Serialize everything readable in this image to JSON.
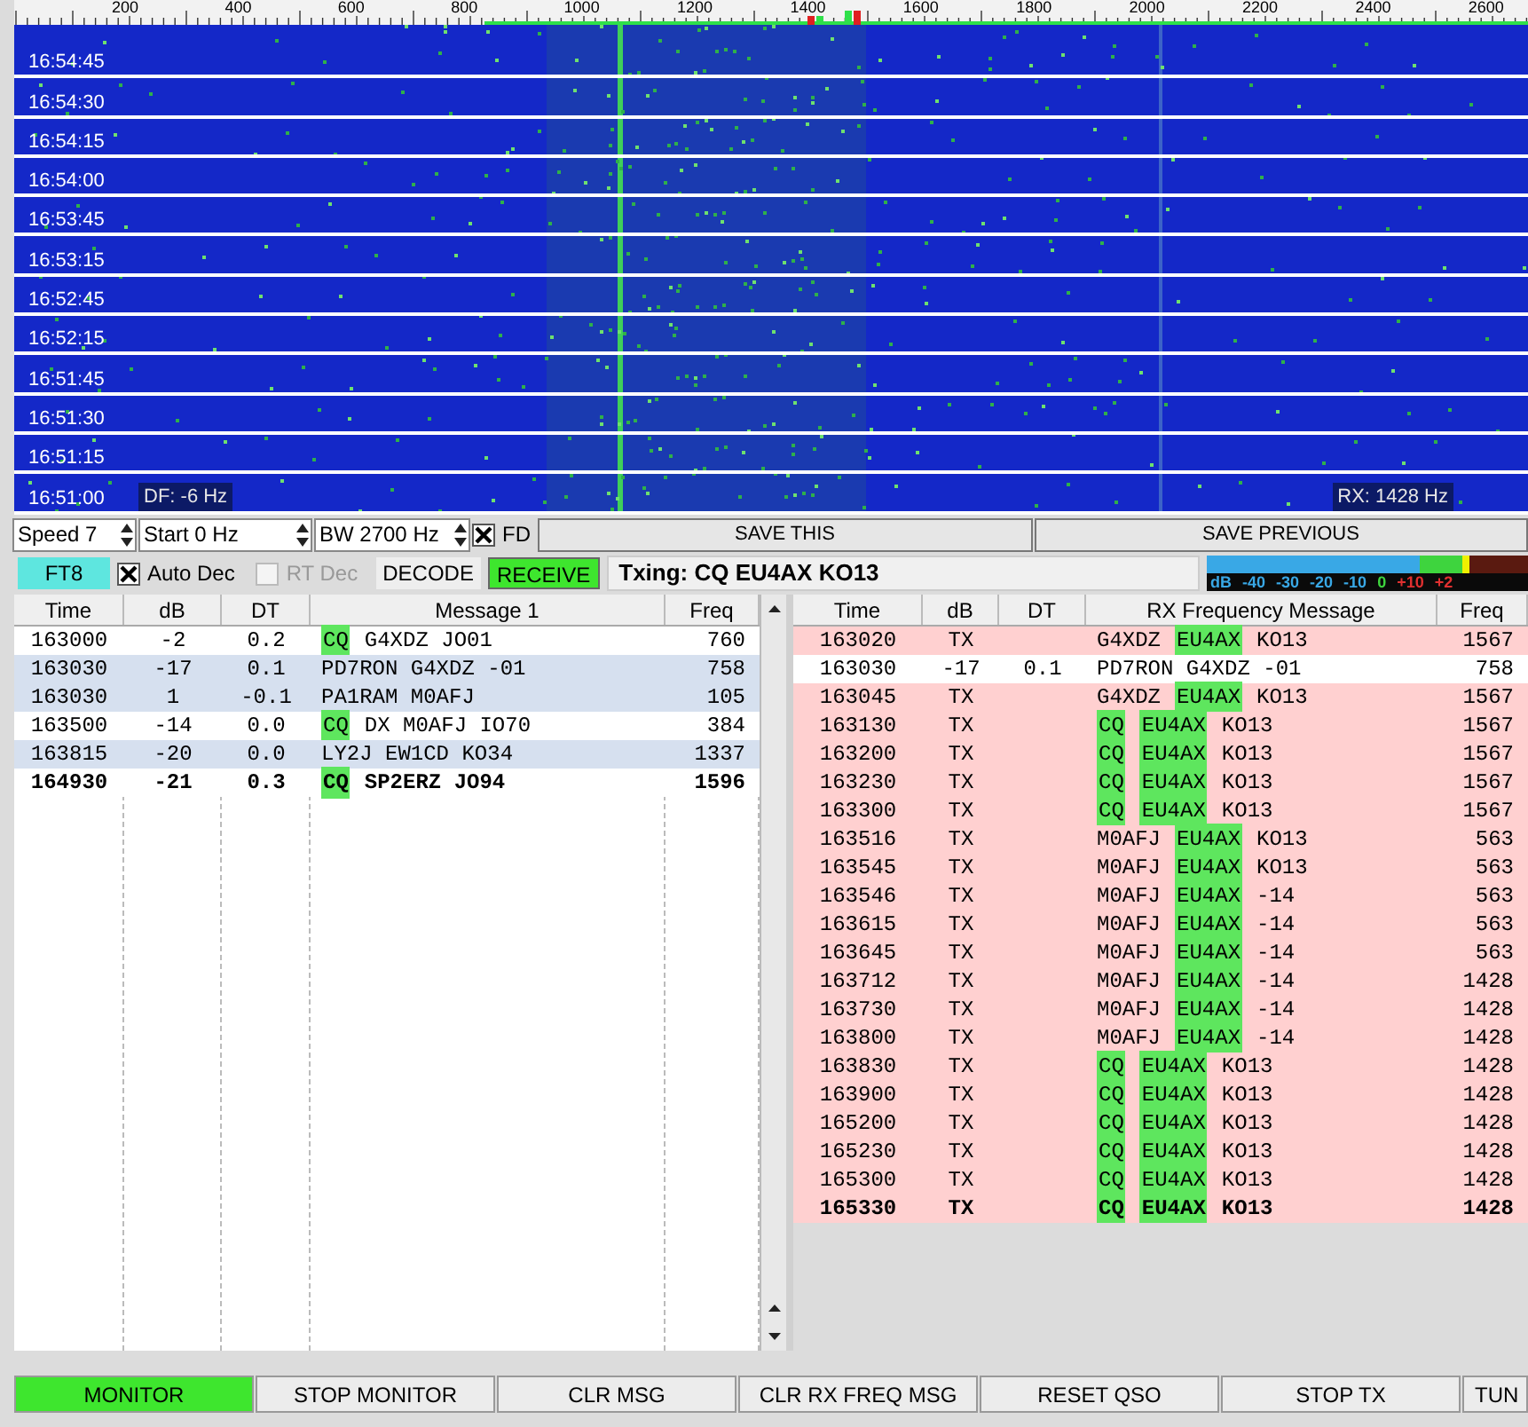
{
  "ruler": {
    "ticks": [
      "200",
      "400",
      "600",
      "800",
      "1000",
      "1200",
      "1400",
      "1600",
      "1800",
      "2000",
      "2200",
      "2400",
      "2600"
    ]
  },
  "waterfall": {
    "times": [
      "16:54:45",
      "16:54:30",
      "16:54:15",
      "16:54:00",
      "16:53:45",
      "16:53:15",
      "16:52:45",
      "16:52:15",
      "16:51:45",
      "16:51:30",
      "16:51:15",
      "16:51:00"
    ],
    "df": "DF: -6 Hz",
    "rx": "RX: 1428 Hz"
  },
  "controls": {
    "speed": "Speed 7",
    "start": "Start 0 Hz",
    "bw": "BW 2700 Hz",
    "fd": {
      "label": "FD",
      "checked": true
    },
    "save_this": "SAVE THIS",
    "save_previous": "SAVE PREVIOUS"
  },
  "mode_bar": {
    "mode": "FT8",
    "auto_dec": {
      "label": "Auto Dec",
      "checked": true,
      "disabled": false
    },
    "rt_dec": {
      "label": "RT Dec",
      "checked": false,
      "disabled": true
    },
    "decode": "DECODE",
    "receive": {
      "label": "RECEIVE",
      "on": true
    },
    "txing": "Txing: CQ EU4AX KO13",
    "meter_labels": [
      "dB",
      "-40",
      "-30",
      "-20",
      "-10",
      "0",
      "+10",
      "+2"
    ]
  },
  "band_activity": {
    "columns": [
      "Time",
      "dB",
      "DT",
      "Message 1",
      "Freq"
    ],
    "rows": [
      {
        "time": "163000",
        "db": "-2",
        "dt": "0.2",
        "message": [
          {
            "text": "CQ",
            "highlight": true
          },
          {
            "text": "G4XDZ JO01",
            "highlight": false
          }
        ],
        "freq": "760",
        "shaded": false,
        "bold": false
      },
      {
        "time": "163030",
        "db": "-17",
        "dt": "0.1",
        "message": [
          {
            "text": "PD7RON G4XDZ -01",
            "highlight": false
          }
        ],
        "freq": "758",
        "shaded": true,
        "bold": false
      },
      {
        "time": "163030",
        "db": "1",
        "dt": "-0.1",
        "message": [
          {
            "text": "PA1RAM M0AFJ",
            "highlight": false
          }
        ],
        "freq": "105",
        "shaded": true,
        "bold": false
      },
      {
        "time": "163500",
        "db": "-14",
        "dt": "0.0",
        "message": [
          {
            "text": "CQ",
            "highlight": true
          },
          {
            "text": "DX M0AFJ IO70",
            "highlight": false
          }
        ],
        "freq": "384",
        "shaded": false,
        "bold": false
      },
      {
        "time": "163815",
        "db": "-20",
        "dt": "0.0",
        "message": [
          {
            "text": "LY2J EW1CD KO34",
            "highlight": false
          }
        ],
        "freq": "1337",
        "shaded": true,
        "bold": false
      },
      {
        "time": "164930",
        "db": "-21",
        "dt": "0.3",
        "message": [
          {
            "text": "CQ",
            "highlight": true
          },
          {
            "text": "SP2ERZ JO94",
            "highlight": false
          }
        ],
        "freq": "1596",
        "shaded": false,
        "bold": true
      }
    ]
  },
  "rx_frequency": {
    "columns": [
      "Time",
      "dB",
      "DT",
      "RX Frequency Message",
      "Freq"
    ],
    "rows": [
      {
        "kind": "tx",
        "time": "163020",
        "db": "TX",
        "message": [
          {
            "text": "G4XDZ",
            "highlight": false
          },
          {
            "text": "EU4AX",
            "highlight": true
          },
          {
            "text": "KO13",
            "highlight": false
          }
        ],
        "freq": "1567",
        "bold": false
      },
      {
        "kind": "rx",
        "time": "163030",
        "db": "-17",
        "dt": "0.1",
        "message": [
          {
            "text": "PD7RON G4XDZ -01",
            "highlight": false
          }
        ],
        "freq": "758",
        "bold": false
      },
      {
        "kind": "tx",
        "time": "163045",
        "db": "TX",
        "message": [
          {
            "text": "G4XDZ",
            "highlight": false
          },
          {
            "text": "EU4AX",
            "highlight": true
          },
          {
            "text": "KO13",
            "highlight": false
          }
        ],
        "freq": "1567",
        "bold": false
      },
      {
        "kind": "tx",
        "time": "163130",
        "db": "TX",
        "message": [
          {
            "text": "CQ",
            "highlight": true
          },
          {
            "text": "EU4AX",
            "highlight": true
          },
          {
            "text": "KO13",
            "highlight": false
          }
        ],
        "freq": "1567",
        "bold": false
      },
      {
        "kind": "tx",
        "time": "163200",
        "db": "TX",
        "message": [
          {
            "text": "CQ",
            "highlight": true
          },
          {
            "text": "EU4AX",
            "highlight": true
          },
          {
            "text": "KO13",
            "highlight": false
          }
        ],
        "freq": "1567",
        "bold": false
      },
      {
        "kind": "tx",
        "time": "163230",
        "db": "TX",
        "message": [
          {
            "text": "CQ",
            "highlight": true
          },
          {
            "text": "EU4AX",
            "highlight": true
          },
          {
            "text": "KO13",
            "highlight": false
          }
        ],
        "freq": "1567",
        "bold": false
      },
      {
        "kind": "tx",
        "time": "163300",
        "db": "TX",
        "message": [
          {
            "text": "CQ",
            "highlight": true
          },
          {
            "text": "EU4AX",
            "highlight": true
          },
          {
            "text": "KO13",
            "highlight": false
          }
        ],
        "freq": "1567",
        "bold": false
      },
      {
        "kind": "tx",
        "time": "163516",
        "db": "TX",
        "message": [
          {
            "text": "M0AFJ",
            "highlight": false
          },
          {
            "text": "EU4AX",
            "highlight": true
          },
          {
            "text": "KO13",
            "highlight": false
          }
        ],
        "freq": "563",
        "bold": false
      },
      {
        "kind": "tx",
        "time": "163545",
        "db": "TX",
        "message": [
          {
            "text": "M0AFJ",
            "highlight": false
          },
          {
            "text": "EU4AX",
            "highlight": true
          },
          {
            "text": "KO13",
            "highlight": false
          }
        ],
        "freq": "563",
        "bold": false
      },
      {
        "kind": "tx",
        "time": "163546",
        "db": "TX",
        "message": [
          {
            "text": "M0AFJ",
            "highlight": false
          },
          {
            "text": "EU4AX",
            "highlight": true
          },
          {
            "text": "-14",
            "highlight": false
          }
        ],
        "freq": "563",
        "bold": false
      },
      {
        "kind": "tx",
        "time": "163615",
        "db": "TX",
        "message": [
          {
            "text": "M0AFJ",
            "highlight": false
          },
          {
            "text": "EU4AX",
            "highlight": true
          },
          {
            "text": "-14",
            "highlight": false
          }
        ],
        "freq": "563",
        "bold": false
      },
      {
        "kind": "tx",
        "time": "163645",
        "db": "TX",
        "message": [
          {
            "text": "M0AFJ",
            "highlight": false
          },
          {
            "text": "EU4AX",
            "highlight": true
          },
          {
            "text": "-14",
            "highlight": false
          }
        ],
        "freq": "563",
        "bold": false
      },
      {
        "kind": "tx",
        "time": "163712",
        "db": "TX",
        "message": [
          {
            "text": "M0AFJ",
            "highlight": false
          },
          {
            "text": "EU4AX",
            "highlight": true
          },
          {
            "text": "-14",
            "highlight": false
          }
        ],
        "freq": "1428",
        "bold": false
      },
      {
        "kind": "tx",
        "time": "163730",
        "db": "TX",
        "message": [
          {
            "text": "M0AFJ",
            "highlight": false
          },
          {
            "text": "EU4AX",
            "highlight": true
          },
          {
            "text": "-14",
            "highlight": false
          }
        ],
        "freq": "1428",
        "bold": false
      },
      {
        "kind": "tx",
        "time": "163800",
        "db": "TX",
        "message": [
          {
            "text": "M0AFJ",
            "highlight": false
          },
          {
            "text": "EU4AX",
            "highlight": true
          },
          {
            "text": "-14",
            "highlight": false
          }
        ],
        "freq": "1428",
        "bold": false
      },
      {
        "kind": "tx",
        "time": "163830",
        "db": "TX",
        "message": [
          {
            "text": "CQ",
            "highlight": true
          },
          {
            "text": "EU4AX",
            "highlight": true
          },
          {
            "text": "KO13",
            "highlight": false
          }
        ],
        "freq": "1428",
        "bold": false
      },
      {
        "kind": "tx",
        "time": "163900",
        "db": "TX",
        "message": [
          {
            "text": "CQ",
            "highlight": true
          },
          {
            "text": "EU4AX",
            "highlight": true
          },
          {
            "text": "KO13",
            "highlight": false
          }
        ],
        "freq": "1428",
        "bold": false
      },
      {
        "kind": "tx",
        "time": "165200",
        "db": "TX",
        "message": [
          {
            "text": "CQ",
            "highlight": true
          },
          {
            "text": "EU4AX",
            "highlight": true
          },
          {
            "text": "KO13",
            "highlight": false
          }
        ],
        "freq": "1428",
        "bold": false
      },
      {
        "kind": "tx",
        "time": "165230",
        "db": "TX",
        "message": [
          {
            "text": "CQ",
            "highlight": true
          },
          {
            "text": "EU4AX",
            "highlight": true
          },
          {
            "text": "KO13",
            "highlight": false
          }
        ],
        "freq": "1428",
        "bold": false
      },
      {
        "kind": "tx",
        "time": "165300",
        "db": "TX",
        "message": [
          {
            "text": "CQ",
            "highlight": true
          },
          {
            "text": "EU4AX",
            "highlight": true
          },
          {
            "text": "KO13",
            "highlight": false
          }
        ],
        "freq": "1428",
        "bold": false
      },
      {
        "kind": "tx",
        "time": "165330",
        "db": "TX",
        "message": [
          {
            "text": "CQ",
            "highlight": true
          },
          {
            "text": "EU4AX",
            "highlight": true
          },
          {
            "text": "KO13",
            "highlight": false
          }
        ],
        "freq": "1428",
        "bold": true
      }
    ]
  },
  "buttons": [
    {
      "label": "MONITOR",
      "on": true
    },
    {
      "label": "STOP MONITOR",
      "on": false
    },
    {
      "label": "CLR MSG",
      "on": false
    },
    {
      "label": "CLR RX FREQ MSG",
      "on": false
    },
    {
      "label": "RESET QSO",
      "on": false
    },
    {
      "label": "STOP TX",
      "on": false
    },
    {
      "label": "TUN",
      "on": false
    }
  ]
}
